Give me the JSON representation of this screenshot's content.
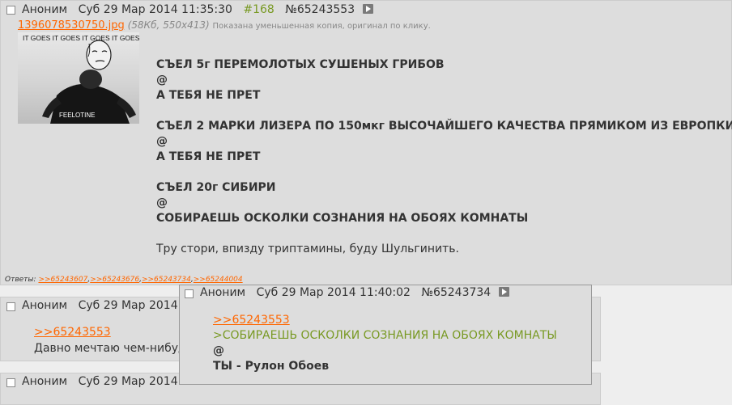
{
  "post1": {
    "name": "Аноним",
    "date": "Суб 29 Мар 2014 11:35:30",
    "ordinal": "#168",
    "number": "№65243553",
    "file": {
      "name": "1396078530750.jpg",
      "meta": "(58Кб, 550x413)",
      "note": "Показана уменьшенная копия, оригинал по клику.",
      "thumb_top_text": "IT GOES IT GOES IT GOES IT GOES",
      "thumb_bottom_text": "FEELOTINE"
    },
    "lines": [
      "СЪЕЛ 5г ПЕРЕМОЛОТЫХ СУШЕНЫХ ГРИБОВ",
      "@",
      "А ТЕБЯ НЕ ПРЕТ",
      "СЪЕЛ 2 МАРКИ ЛИЗЕРА ПО 150мкг ВЫСОЧАЙШЕГО КАЧЕСТВА ПРЯМИКОМ ИЗ ЕВРОПКИ",
      "@",
      "А ТЕБЯ НЕ ПРЕТ",
      "СЪЕЛ 20г СИБИРИ",
      "@",
      "СОБИРАЕШЬ ОСКОЛКИ СОЗНАНИЯ НА ОБОЯХ КОМНАТЫ"
    ],
    "plain_line": "Тру стори, впизду триптамины, буду Шульгинить.",
    "replies_label": "Ответы:",
    "replies": [
      ">>65243607",
      ">>65243676",
      ">>65243734",
      ">>65244004"
    ]
  },
  "post2": {
    "name": "Аноним",
    "date": "Суб 29 Мар 2014",
    "ref_link": ">>65243553",
    "text": "Давно мечтаю чем-нибуд"
  },
  "post3": {
    "name": "Аноним",
    "date": "Суб 29 Мар 2014"
  },
  "popup": {
    "name": "Аноним",
    "date": "Суб 29 Мар 2014 11:40:02",
    "number": "№65243734",
    "ref_link": ">>65243553",
    "quote": ">СОБИРАЕШЬ ОСКОЛКИ СОЗНАНИЯ НА ОБОЯХ КОМНАТЫ",
    "at": "@",
    "bold_line": "ТЫ - Рулон Обоев"
  },
  "colors": {
    "link": "#ff6600",
    "quote": "#789922",
    "post_bg": "#dddddd",
    "page_bg": "#eeeeee"
  }
}
